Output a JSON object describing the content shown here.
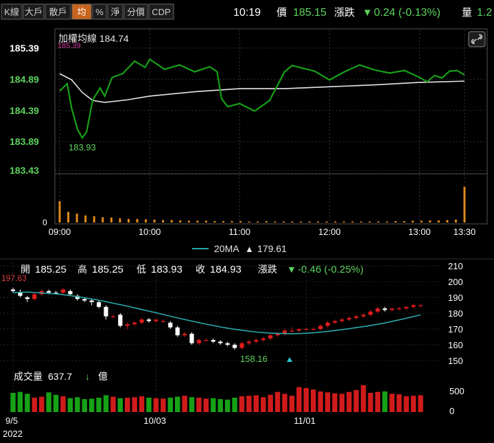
{
  "toolbar": {
    "tabs": [
      "K線",
      "大戶",
      "散戶",
      "均",
      "%",
      "淨",
      "分價",
      "CDP"
    ],
    "active_tab": "均"
  },
  "header": {
    "time": "10:19",
    "price_label": "價",
    "price": "185.15",
    "change_label": "漲跌",
    "change_arrow": "▼",
    "change": "0.24 (-0.13%)",
    "volume_label": "量",
    "volume": "1.2"
  },
  "intraday": {
    "legend": "加權均線 184.74",
    "link_icon": "link-icon",
    "y_ticks": [
      {
        "label": "185.39",
        "value": 185.39,
        "color": "#ffffff"
      },
      {
        "label": "184.89",
        "value": 184.89,
        "color": "#5ed35e"
      },
      {
        "label": "184.39",
        "value": 184.39,
        "color": "#5ed35e"
      },
      {
        "label": "183.89",
        "value": 183.89,
        "color": "#5ed35e"
      },
      {
        "label": "183.43",
        "value": 183.43,
        "color": "#5ed35e"
      }
    ],
    "overlay_label": "185.39",
    "low_label": "183.93",
    "vol_zero": "0",
    "x_ticks": [
      "09:00",
      "10:00",
      "11:00",
      "12:00",
      "13:00",
      "13:30"
    ],
    "colors": {
      "price": "#17a117",
      "avg": "#e6e6e6",
      "volume": "#e08a1e"
    }
  },
  "ma_legend": {
    "name": "20MA",
    "arrow": "▲",
    "value": "179.61"
  },
  "daily": {
    "info": {
      "open_label": "開",
      "open": "185.25",
      "high_label": "高",
      "high": "185.25",
      "low_label": "低",
      "low": "183.93",
      "close_label": "收",
      "close": "184.93",
      "change_label": "漲跌",
      "change_arrow": "▼",
      "change": "-0.46 (-0.25%)"
    },
    "high_marker": "197.63",
    "low_marker": "158.16",
    "right_ticks": [
      "210",
      "200",
      "190",
      "180",
      "170",
      "160",
      "150"
    ],
    "volume_label": "成交量",
    "volume_value": "637.7",
    "volume_arrow": "↓",
    "volume_unit": "億",
    "vol_ticks": [
      "500",
      "0"
    ],
    "x_labels": [
      "9/5",
      "10/03",
      "11/01"
    ],
    "year": "2022",
    "colors": {
      "up": "#e01d1d",
      "down": "#ffffff",
      "ma": "#2ba7a7",
      "vol_up": "#d11b1b",
      "vol_down": "#17a117"
    }
  },
  "chart_data": [
    {
      "type": "line",
      "title": "加權均線 184.74",
      "x_ticks": [
        "09:00",
        "10:00",
        "11:00",
        "12:00",
        "13:00",
        "13:30"
      ],
      "ylim": [
        183.43,
        185.39
      ],
      "series": [
        {
          "name": "price",
          "x": [
            "09:00",
            "09:05",
            "09:08",
            "09:12",
            "09:15",
            "09:18",
            "09:22",
            "09:27",
            "09:30",
            "09:35",
            "09:42",
            "09:50",
            "09:57",
            "10:00",
            "10:10",
            "10:20",
            "10:30",
            "10:40",
            "10:45",
            "10:48",
            "10:52",
            "11:00",
            "11:10",
            "11:20",
            "11:30",
            "11:35",
            "11:40",
            "11:50",
            "12:00",
            "12:10",
            "12:20",
            "12:30",
            "12:40",
            "12:50",
            "13:00",
            "13:05",
            "13:10",
            "13:15",
            "13:20",
            "13:25",
            "13:30"
          ],
          "values": [
            184.7,
            184.82,
            184.42,
            184.08,
            183.95,
            184.05,
            184.56,
            184.75,
            184.62,
            184.92,
            184.98,
            185.18,
            185.08,
            185.21,
            185.05,
            185.12,
            185.01,
            185.09,
            185.01,
            184.58,
            184.45,
            184.5,
            184.38,
            184.55,
            185.01,
            185.11,
            185.08,
            185.02,
            184.88,
            185.01,
            185.12,
            185.04,
            184.99,
            185.03,
            184.92,
            184.85,
            184.95,
            184.91,
            185.02,
            185.03,
            184.96
          ]
        },
        {
          "name": "average",
          "x": [
            "09:00",
            "09:08",
            "09:15",
            "09:22",
            "09:30",
            "09:45",
            "10:00",
            "10:30",
            "11:00",
            "11:30",
            "12:00",
            "12:30",
            "13:00",
            "13:30"
          ],
          "values": [
            184.98,
            184.88,
            184.68,
            184.55,
            184.52,
            184.56,
            184.62,
            184.69,
            184.74,
            184.74,
            184.77,
            184.8,
            184.84,
            184.86
          ]
        }
      ]
    },
    {
      "type": "bar",
      "title": "",
      "x_ticks": [
        "09:00",
        "10:00",
        "11:00",
        "12:00",
        "13:00",
        "13:30"
      ],
      "ylim": [
        0,
        1
      ],
      "series": [
        {
          "name": "volume",
          "values": [
            0.6,
            0.3,
            0.25,
            0.2,
            0.18,
            0.15,
            0.14,
            0.12,
            0.1,
            0.1,
            0.09,
            0.08,
            0.07,
            0.07,
            0.06,
            0.05,
            0.05,
            0.05,
            0.04,
            0.04,
            0.04,
            0.04,
            0.03,
            0.03,
            0.04,
            0.03,
            0.03,
            0.03,
            0.03,
            0.03,
            0.03,
            0.03,
            0.03,
            0.03,
            0.03,
            0.03,
            0.03,
            0.03,
            0.03,
            0.04,
            0.04,
            0.05,
            0.05,
            0.06,
            0.06,
            0.07,
            0.08,
            1.0
          ]
        }
      ]
    },
    {
      "type": "candlestick",
      "title": "",
      "x_labels": [
        "9/5",
        "10/03",
        "11/01"
      ],
      "ylim": [
        150,
        210
      ],
      "series": [
        {
          "name": "ohlc",
          "values": [
            [
              195,
              196,
              193,
              194
            ],
            [
              193,
              195,
              190,
              191
            ],
            [
              190,
              191,
              187,
              189
            ],
            [
              189,
              193,
              188,
              192
            ],
            [
              192,
              195,
              191,
              194
            ],
            [
              194,
              195,
              192,
              193
            ],
            [
              193,
              194,
              192,
              192
            ],
            [
              193,
              196,
              192,
              195
            ],
            [
              194,
              195,
              191,
              192
            ],
            [
              191,
              192,
              188,
              189
            ],
            [
              189,
              190,
              187,
              188
            ],
            [
              188,
              189,
              185,
              187
            ],
            [
              187,
              188,
              183,
              184
            ],
            [
              184,
              185,
              176,
              178
            ],
            [
              178,
              179,
              177,
              178
            ],
            [
              179,
              180,
              171,
              172
            ],
            [
              172,
              174,
              170,
              173
            ],
            [
              173,
              175,
              172,
              174
            ],
            [
              174,
              177,
              173,
              176
            ],
            [
              176,
              177,
              174,
              175
            ],
            [
              175,
              176,
              174,
              176
            ],
            [
              175,
              176,
              174,
              175
            ],
            [
              174,
              175,
              170,
              171
            ],
            [
              171,
              172,
              165,
              166
            ],
            [
              166,
              168,
              165,
              167
            ],
            [
              167,
              168,
              160,
              161
            ],
            [
              161,
              164,
              160,
              163
            ],
            [
              163,
              164,
              162,
              163
            ],
            [
              163,
              164,
              161,
              162
            ],
            [
              162,
              163,
              160,
              161
            ],
            [
              161,
              162,
              159,
              160
            ],
            [
              160,
              161,
              157,
              158
            ],
            [
              158,
              162,
              157,
              161
            ],
            [
              161,
              163,
              160,
              162
            ],
            [
              162,
              164,
              161,
              163
            ],
            [
              163,
              165,
              162,
              164
            ],
            [
              164,
              167,
              163,
              166
            ],
            [
              166,
              168,
              165,
              167
            ],
            [
              167,
              170,
              166,
              169
            ],
            [
              169,
              171,
              168,
              169
            ],
            [
              169,
              170,
              168,
              170
            ],
            [
              170,
              171,
              169,
              170
            ],
            [
              170,
              171,
              169,
              170
            ],
            [
              170,
              173,
              169,
              172
            ],
            [
              172,
              175,
              171,
              174
            ],
            [
              174,
              176,
              173,
              175
            ],
            [
              175,
              177,
              174,
              176
            ],
            [
              176,
              178,
              175,
              177
            ],
            [
              177,
              179,
              176,
              178
            ],
            [
              178,
              180,
              177,
              179
            ],
            [
              179,
              182,
              178,
              181
            ],
            [
              181,
              184,
              180,
              183
            ],
            [
              183,
              184,
              181,
              182
            ],
            [
              182,
              183,
              181,
              183
            ],
            [
              183,
              184,
              182,
              183
            ],
            [
              183,
              184,
              182,
              184
            ],
            [
              184,
              186,
              183,
              185
            ],
            [
              185,
              186,
              184,
              185
            ]
          ]
        },
        {
          "name": "20MA",
          "values": [
            193,
            193.2,
            193.4,
            193.1,
            192.8,
            192.5,
            192.2,
            191.7,
            191.1,
            190.5,
            189.8,
            189,
            188.2,
            187.3,
            186.3,
            185.4,
            184.4,
            183.4,
            182.3,
            181.3,
            180.3,
            179.2,
            178.1,
            177,
            176,
            175,
            174,
            173.1,
            172.2,
            171.3,
            170.5,
            169.8,
            169.2,
            168.6,
            168.1,
            167.7,
            167.4,
            167.2,
            167.1,
            167,
            167.1,
            167.3,
            167.6,
            168,
            168.5,
            169,
            169.6,
            170.2,
            170.9,
            171.5,
            172.2,
            173,
            173.8,
            174.8,
            175.8,
            176.8,
            177.9,
            178.9
          ]
        },
        {
          "name": "成交量",
          "values": [
            400,
            420,
            380,
            300,
            320,
            410,
            360,
            330,
            290,
            310,
            270,
            280,
            300,
            350,
            320,
            290,
            300,
            310,
            330,
            300,
            290,
            280,
            300,
            320,
            340,
            310,
            300,
            280,
            290,
            270,
            260,
            300,
            330,
            340,
            350,
            310,
            360,
            420,
            380,
            340,
            520,
            500,
            470,
            430,
            410,
            390,
            380,
            420,
            460,
            560,
            400,
            420,
            430,
            380,
            370,
            330,
            340,
            350
          ]
        }
      ]
    }
  ]
}
